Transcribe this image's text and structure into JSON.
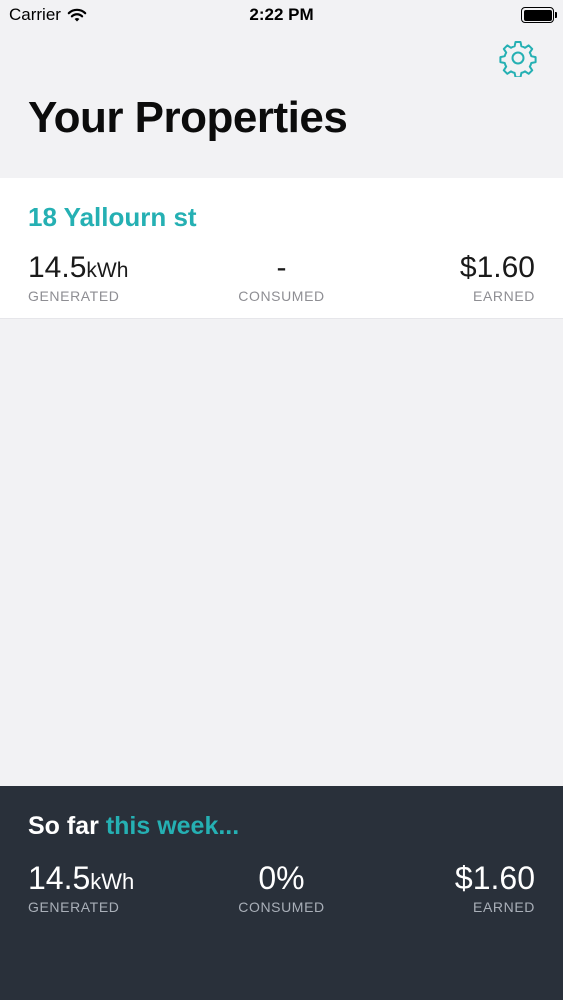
{
  "status_bar": {
    "carrier": "Carrier",
    "time": "2:22 PM"
  },
  "header": {
    "title": "Your Properties",
    "settings_icon": "gear-icon"
  },
  "properties": [
    {
      "name": "18 Yallourn st",
      "generated_value": "14.5",
      "generated_unit": "kWh",
      "generated_label": "GENERATED",
      "consumed_value": "-",
      "consumed_label": "CONSUMED",
      "earned_value": "$1.60",
      "earned_label": "EARNED"
    }
  ],
  "week_summary": {
    "title_prefix": "So far",
    "title_accent": "this week...",
    "generated_value": "14.5",
    "generated_unit": "kWh",
    "generated_label": "GENERATED",
    "consumed_value": "0%",
    "consumed_label": "CONSUMED",
    "earned_value": "$1.60",
    "earned_label": "EARNED"
  },
  "colors": {
    "accent": "#25b0b3",
    "panel": "#29303a",
    "background": "#f2f2f4"
  }
}
